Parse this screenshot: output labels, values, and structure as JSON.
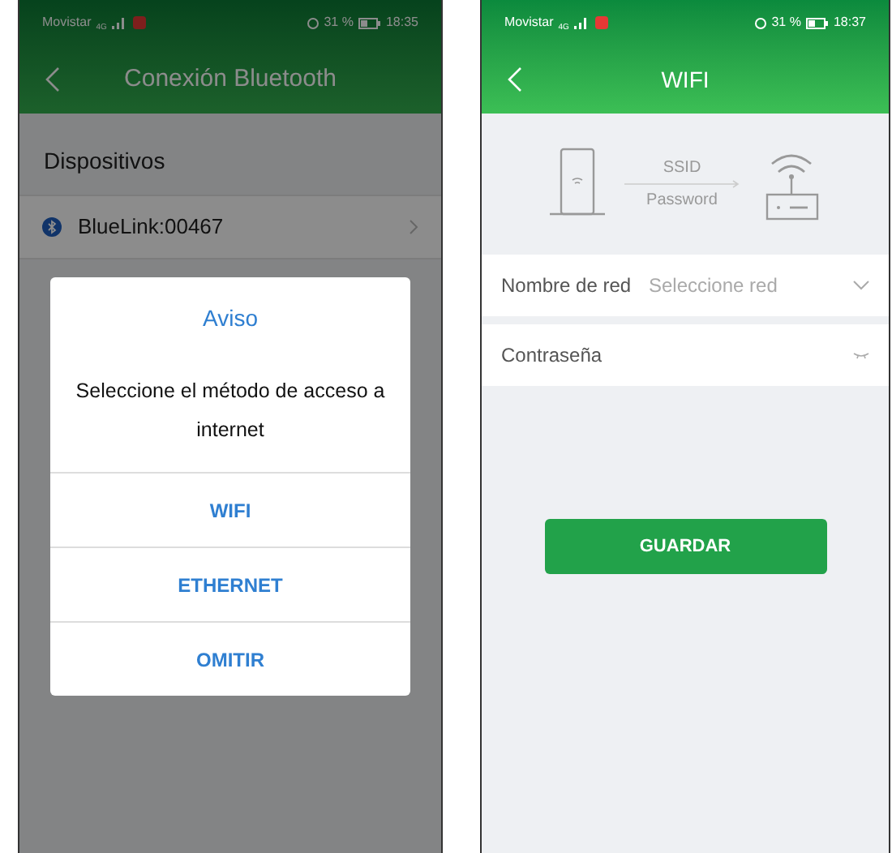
{
  "bluetooth_screen": {
    "status_bar": {
      "carrier": "Movistar",
      "network": "4G",
      "battery": "31 %",
      "time": "18:35"
    },
    "title": "Conexión Bluetooth",
    "section": "Dispositivos",
    "devices": [
      {
        "name": "BlueLink:00467"
      }
    ],
    "dialog": {
      "title": "Aviso",
      "message": "Seleccione el método de acceso a internet",
      "options": [
        "WIFI",
        "ETHERNET",
        "OMITIR"
      ]
    }
  },
  "wifi_screen": {
    "status_bar": {
      "carrier": "Movistar",
      "network": "4G",
      "battery": "31 %",
      "time": "18:37"
    },
    "title": "WIFI",
    "diagram": {
      "label_1": "SSID",
      "label_2": "Password"
    },
    "fields": [
      {
        "kind": "select",
        "label": "Nombre de red",
        "placeholder": "Seleccione red"
      },
      {
        "kind": "password",
        "label": "Contraseña"
      }
    ],
    "button": "GUARDAR"
  }
}
